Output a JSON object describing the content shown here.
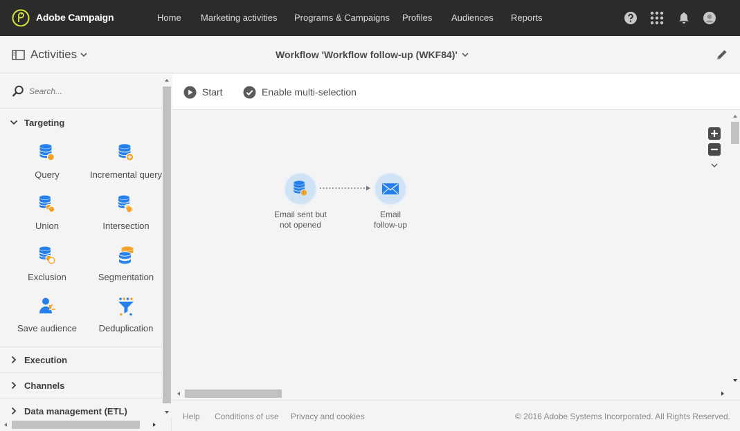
{
  "topbar": {
    "app_title": "Adobe Campaign",
    "nav": [
      "Home",
      "Marketing activities",
      "Programs & Campaigns",
      "Profiles",
      "Audiences",
      "Reports"
    ],
    "icons": [
      "help-icon",
      "apps-grid-icon",
      "bell-icon",
      "user-avatar-icon"
    ]
  },
  "subheader": {
    "activities_label": "Activities",
    "workflow_title": "Workflow 'Workflow follow-up (WKF84)'"
  },
  "left_panel": {
    "search_placeholder": "Search...",
    "sections": {
      "targeting": "Targeting",
      "execution": "Execution",
      "channels": "Channels",
      "data_management": "Data management (ETL)"
    },
    "activities": [
      {
        "label": "Query",
        "icon": "query-icon"
      },
      {
        "label": "Incremental query",
        "icon": "incremental-query-icon"
      },
      {
        "label": "Union",
        "icon": "union-icon"
      },
      {
        "label": "Intersection",
        "icon": "intersection-icon"
      },
      {
        "label": "Exclusion",
        "icon": "exclusion-icon"
      },
      {
        "label": "Segmentation",
        "icon": "segmentation-icon"
      },
      {
        "label": "Save audience",
        "icon": "save-audience-icon"
      },
      {
        "label": "Deduplication",
        "icon": "deduplication-icon"
      }
    ]
  },
  "toolbar": {
    "start_label": "Start",
    "multi_select_label": "Enable multi-selection"
  },
  "workflow": {
    "nodes": [
      {
        "label_line1": "Email sent but",
        "label_line2": "not opened",
        "icon": "query-icon"
      },
      {
        "label_line1": "Email",
        "label_line2": "follow-up",
        "icon": "email-icon"
      }
    ]
  },
  "footer": {
    "links": [
      "Help",
      "Conditions of use",
      "Privacy and cookies"
    ],
    "copyright": "© 2016 Adobe Systems Incorporated. All Rights Reserved."
  },
  "colors": {
    "topbar_bg": "#2b2b2b",
    "brand_accent": "#d7e33a",
    "activity_blue": "#2680eb",
    "activity_orange": "#f3a32b"
  }
}
